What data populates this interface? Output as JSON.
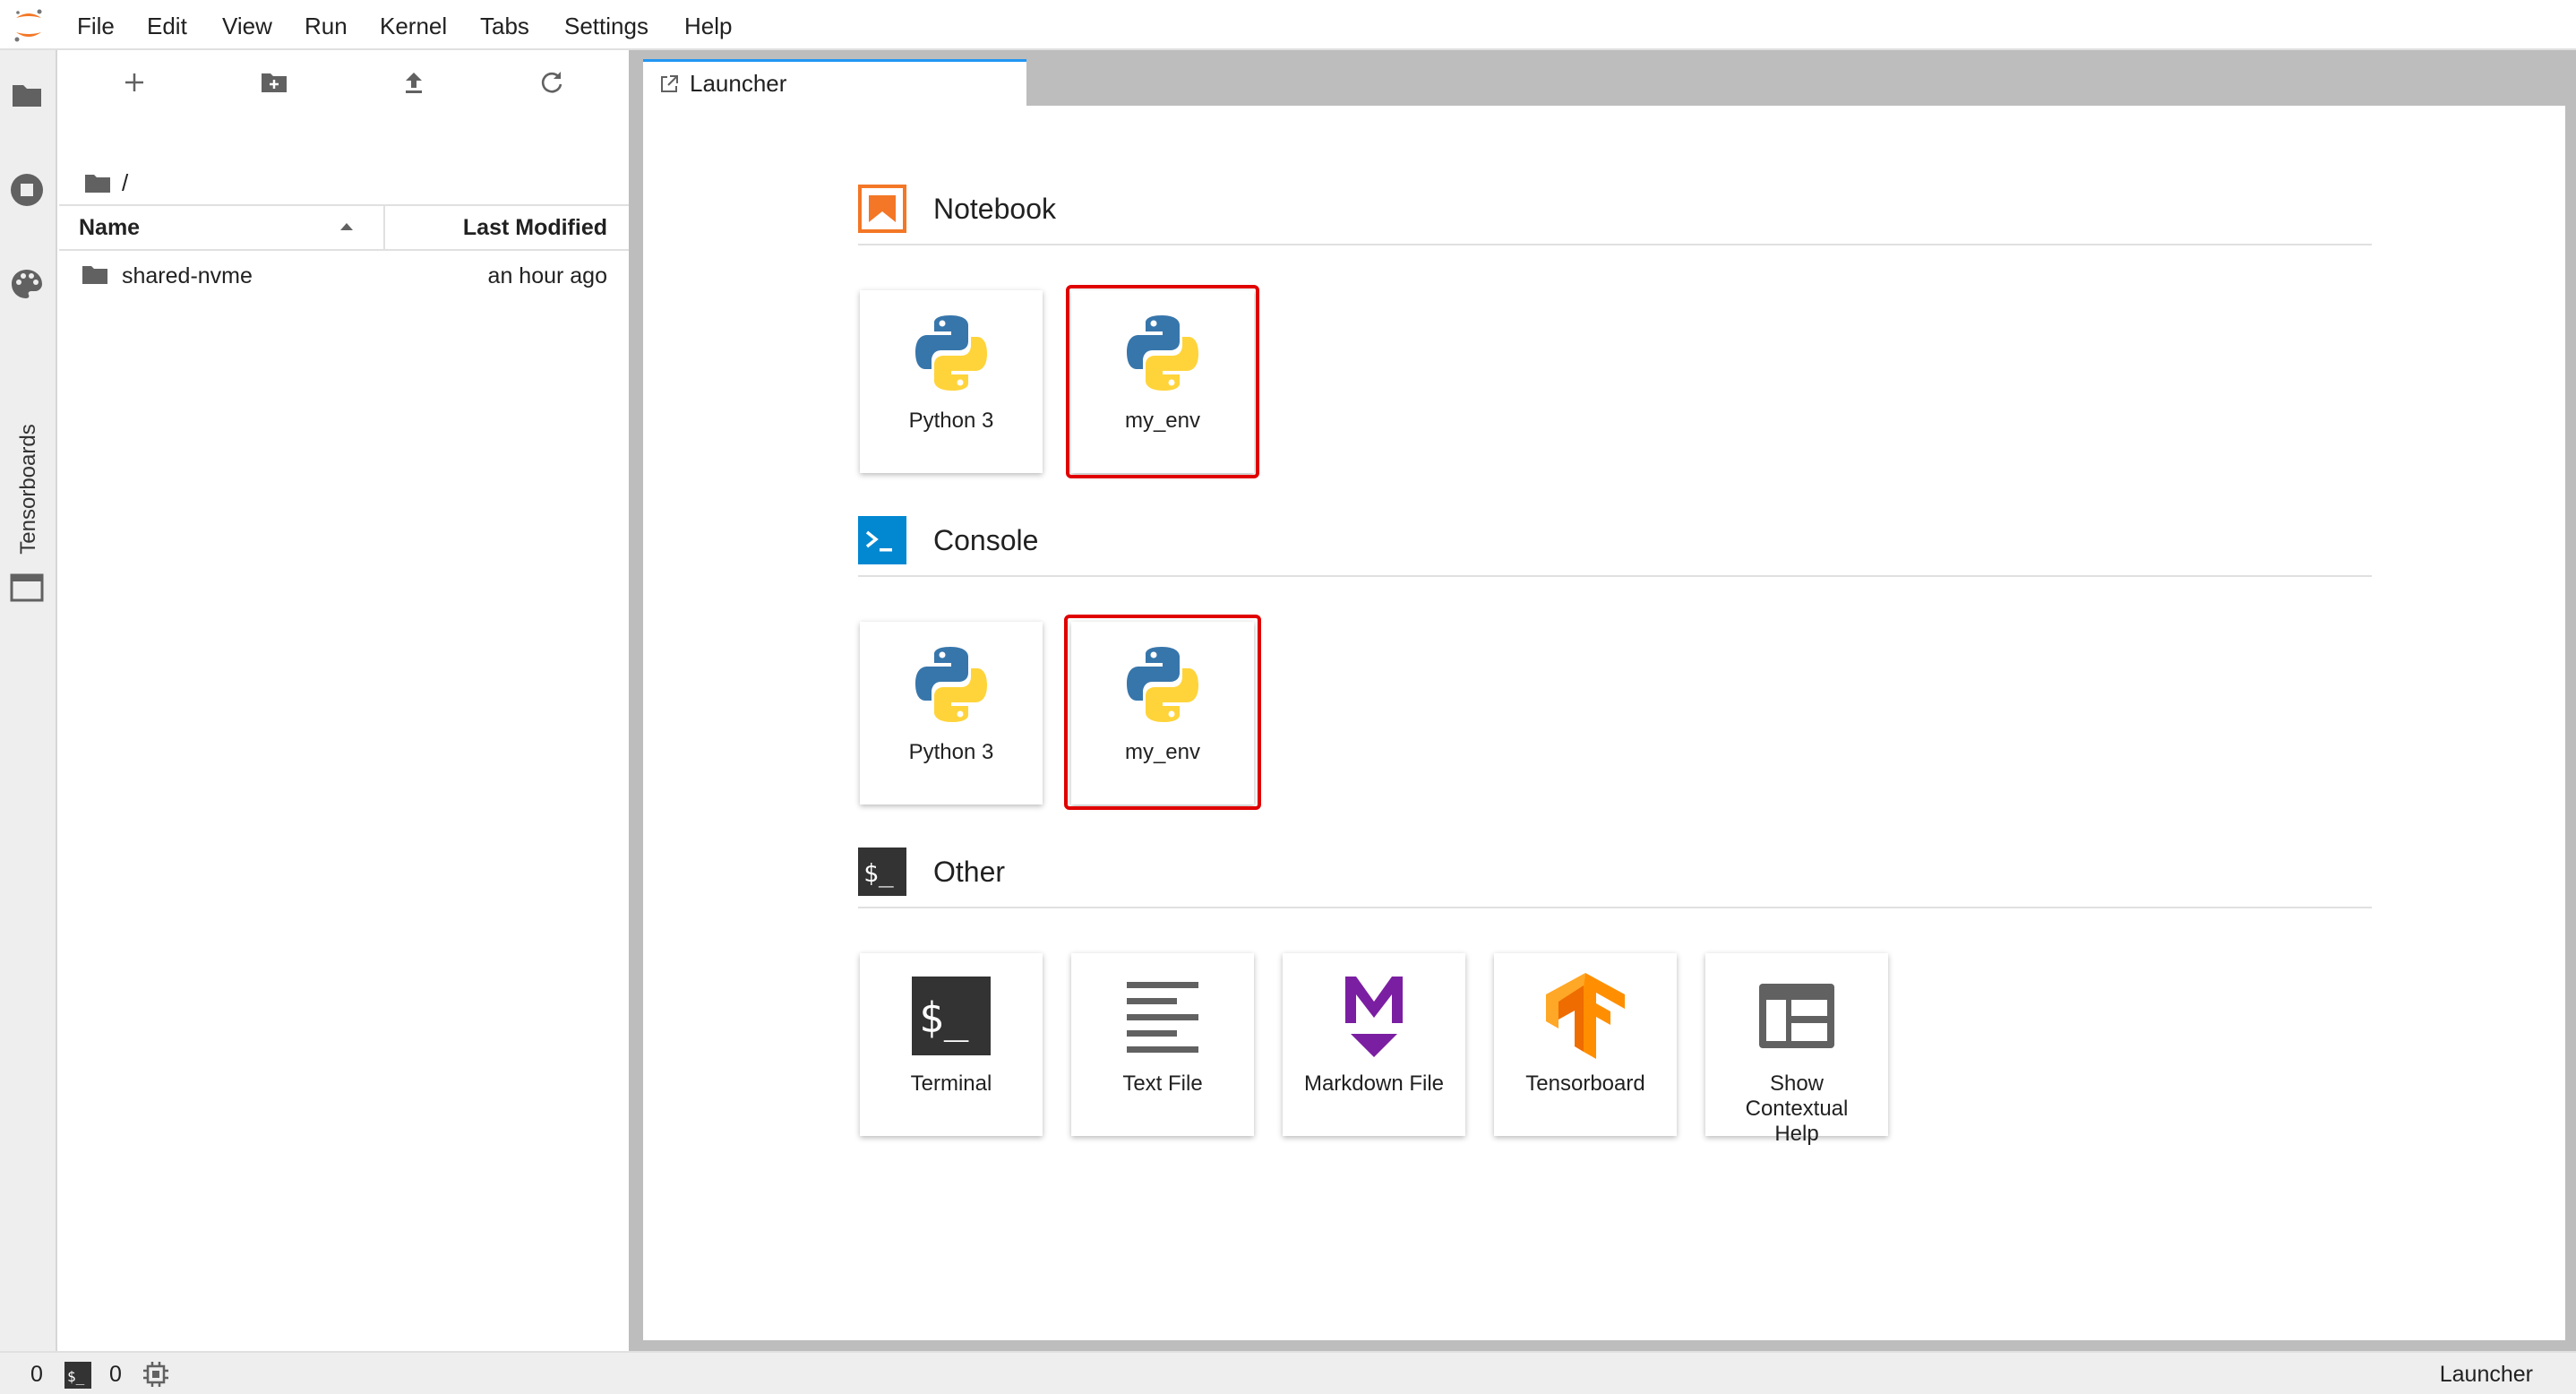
{
  "menu": {
    "items": [
      "File",
      "Edit",
      "View",
      "Run",
      "Kernel",
      "Tabs",
      "Settings",
      "Help"
    ]
  },
  "activity_bar": {
    "tensorboards_label": "Tensorboards"
  },
  "file_browser": {
    "path": "/",
    "columns": {
      "name": "Name",
      "modified": "Last Modified"
    },
    "rows": [
      {
        "name": "shared-nvme",
        "modified": "an hour ago"
      }
    ]
  },
  "main": {
    "tab_label": "Launcher"
  },
  "launcher": {
    "notebook": {
      "title": "Notebook",
      "cards": [
        "Python 3",
        "my_env"
      ]
    },
    "console": {
      "title": "Console",
      "cards": [
        "Python 3",
        "my_env"
      ]
    },
    "other": {
      "title": "Other",
      "cards": [
        "Terminal",
        "Text File",
        "Markdown File",
        "Tensorboard",
        "Show Contextual Help"
      ]
    }
  },
  "statusbar": {
    "kernels_count": "0",
    "terminals_count": "0",
    "right_label": "Launcher"
  },
  "colors": {
    "accent_blue": "#2196f3",
    "highlight_red": "#e00000",
    "notebook_orange": "#f37726",
    "console_blue": "#0288d1",
    "markdown_purple": "#7b1fa2",
    "tensorflow_orange": "#ff6f00"
  }
}
